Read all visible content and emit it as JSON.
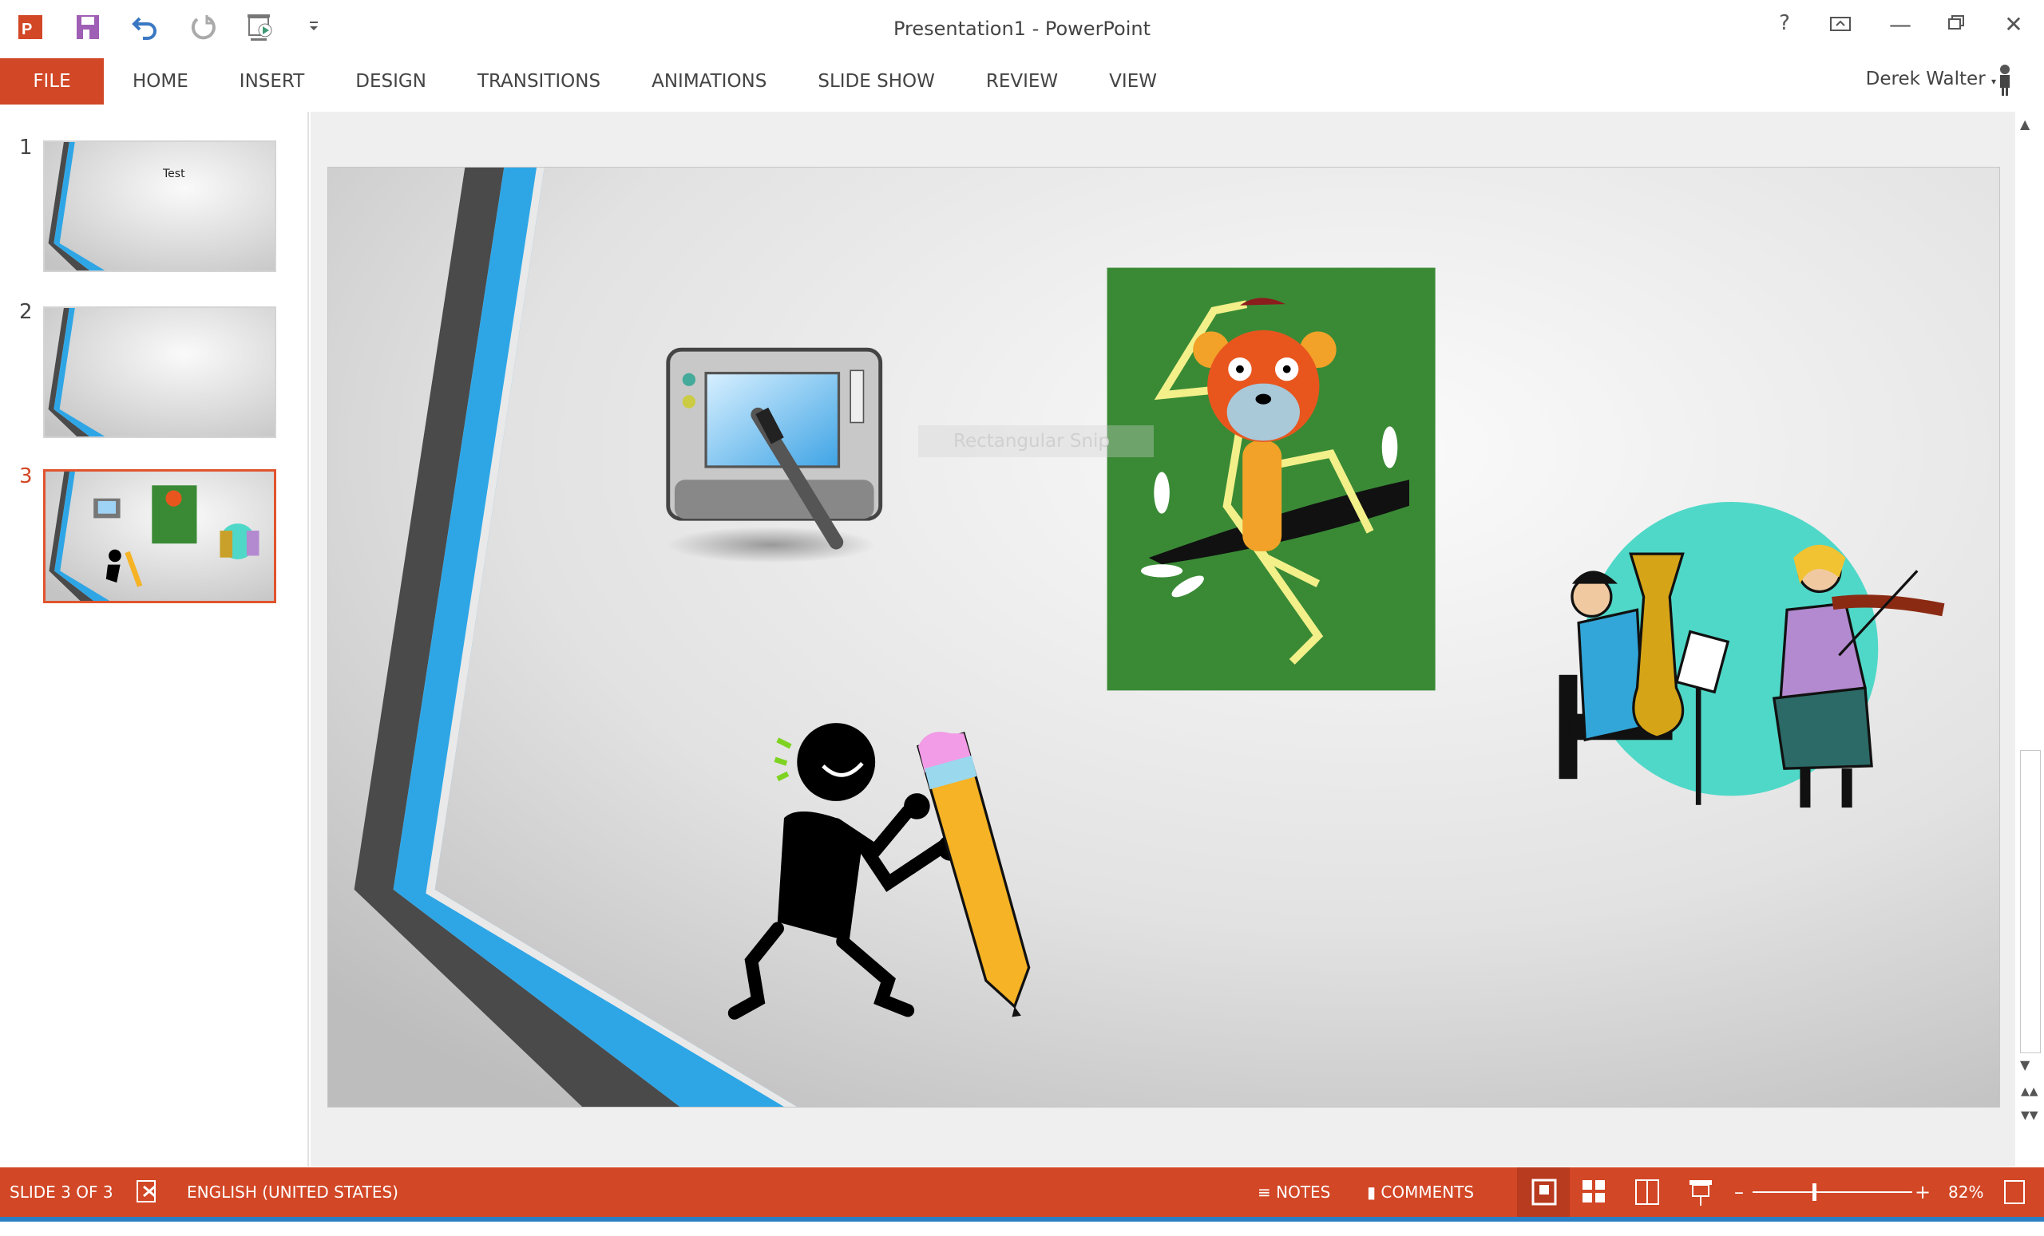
{
  "window": {
    "title": "Presentation1 - PowerPoint",
    "help": "?"
  },
  "quick_access": [
    {
      "icon": "powerpoint-logo-icon"
    },
    {
      "icon": "save-icon"
    },
    {
      "icon": "undo-icon"
    },
    {
      "icon": "redo-icon"
    },
    {
      "icon": "start-from-beginning-icon"
    },
    {
      "icon": "customize-dropdown-icon"
    }
  ],
  "ribbon": {
    "tabs": [
      "FILE",
      "HOME",
      "INSERT",
      "DESIGN",
      "TRANSITIONS",
      "ANIMATIONS",
      "SLIDE SHOW",
      "REVIEW",
      "VIEW"
    ],
    "active": "FILE",
    "user": "Derek Walter"
  },
  "thumbnails": [
    {
      "number": "1",
      "text": "Test"
    },
    {
      "number": "2"
    },
    {
      "number": "3",
      "selected": true
    }
  ],
  "slide": {
    "overlay_text": "Rectangular Snip"
  },
  "status": {
    "slide": "SLIDE 3 OF 3",
    "language": "ENGLISH (UNITED STATES)",
    "notes": "NOTES",
    "comments": "COMMENTS",
    "zoom": "82%",
    "zoom_percent": 82
  },
  "colors": {
    "accent": "#d24726",
    "stripe_blue": "#2ea6e6",
    "stripe_gray": "#4a4a4a",
    "monkey_bg": "#3a8a35"
  }
}
